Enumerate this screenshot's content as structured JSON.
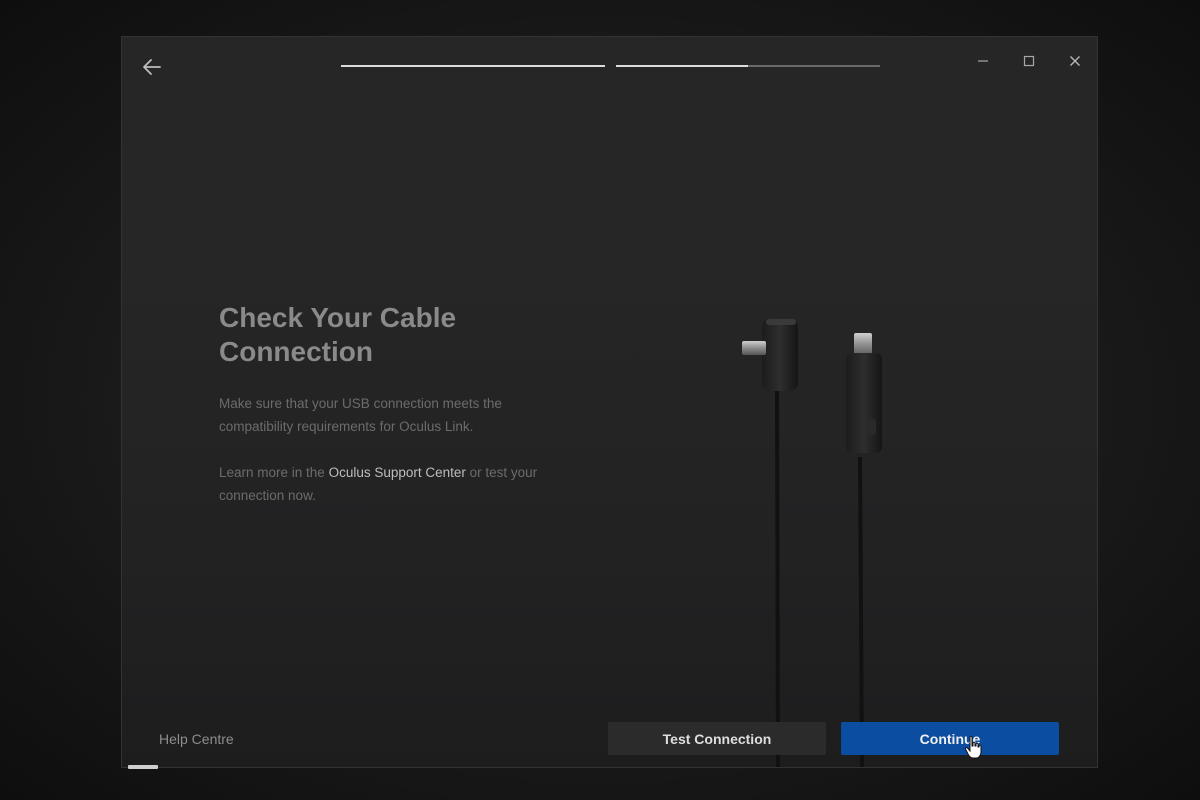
{
  "window": {
    "controls": {
      "minimize": "—",
      "maximize": "□",
      "close": "✕"
    },
    "progress": [
      {
        "step": 1,
        "fill": 1.0
      },
      {
        "step": 2,
        "fill": 0.5
      }
    ]
  },
  "content": {
    "title_line1": "Check Your Cable",
    "title_line2": "Connection",
    "paragraph1": "Make sure that your USB connection meets the compatibility requirements for Oculus Link.",
    "paragraph2_prefix": "Learn more in the ",
    "paragraph2_link": "Oculus Support Center",
    "paragraph2_suffix": " or test your connection now."
  },
  "footer": {
    "help_link": "Help Centre",
    "test_button": "Test Connection",
    "continue_button": "Continue"
  },
  "colors": {
    "accent": "#0b4da0",
    "window_bg": "#262626",
    "title": "#8a8a8a",
    "body_text": "#6c6c6c"
  },
  "icons": {
    "back": "arrow-left-icon",
    "cursor": "hand-pointer-icon"
  }
}
